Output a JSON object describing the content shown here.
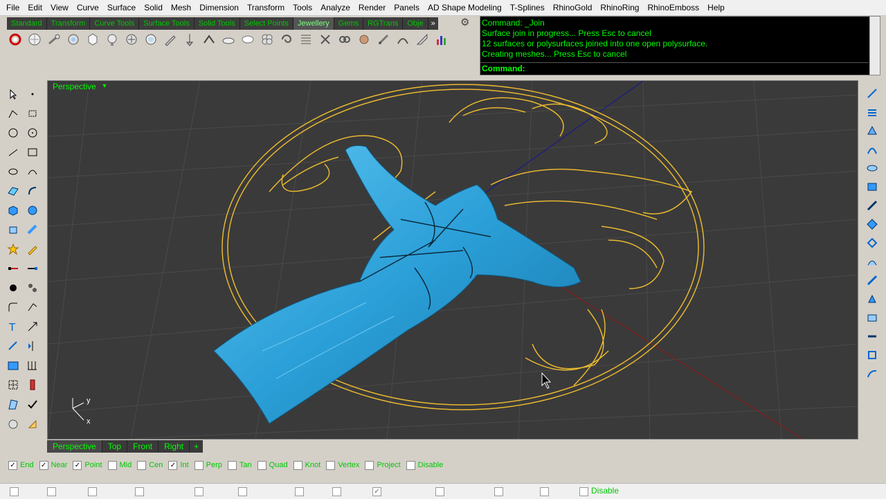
{
  "menubar": {
    "items": [
      "File",
      "Edit",
      "View",
      "Curve",
      "Surface",
      "Solid",
      "Mesh",
      "Dimension",
      "Transform",
      "Tools",
      "Analyze",
      "Render",
      "Panels",
      "AD Shape Modeling",
      "T-Splines",
      "RhinoGold",
      "RhinoRing",
      "RhinoEmboss",
      "Help"
    ]
  },
  "toolbar": {
    "tabs": [
      "Standard",
      "Transform",
      "Curve Tools",
      "Surface Tools",
      "Solid Tools",
      "Select Points",
      "Jewellery",
      "Gems",
      "RGTrans",
      "Obje"
    ],
    "more": "»",
    "active_tab": "Jewellery",
    "icon_names": [
      "ring-icon",
      "gem-cut-icon",
      "setting-icon",
      "prong-icon",
      "bezel-icon",
      "head-icon",
      "chain-icon",
      "pave-icon",
      "cutter-icon",
      "pin-icon",
      "channel-icon",
      "band-icon",
      "pearl-icon",
      "flower-icon",
      "spiral-icon",
      "texture-icon",
      "bracelet-icon",
      "link-icon",
      "bead-icon",
      "clasp-icon",
      "wire-icon",
      "knife-icon",
      "bar-chart-icon"
    ]
  },
  "command": {
    "history": [
      "Command: _Join",
      "Surface join in progress... Press Esc to cancel",
      "12 surfaces or polysurfaces joined into one open polysurface.",
      "Creating meshes... Press Esc to cancel"
    ],
    "prompt": "Command:"
  },
  "viewport": {
    "title": "Perspective",
    "menu_arrow": "▾",
    "axis": {
      "x": "x",
      "y": "y"
    }
  },
  "viewport_tabs": {
    "items": [
      "Perspective",
      "Top",
      "Front",
      "Right"
    ],
    "active": "Perspective",
    "add": "+"
  },
  "osnap": {
    "items": [
      {
        "label": "End",
        "checked": true
      },
      {
        "label": "Near",
        "checked": true
      },
      {
        "label": "Point",
        "checked": true
      },
      {
        "label": "Mid",
        "checked": false
      },
      {
        "label": "Cen",
        "checked": false
      },
      {
        "label": "Int",
        "checked": true
      },
      {
        "label": "Perp",
        "checked": false
      },
      {
        "label": "Tan",
        "checked": false
      },
      {
        "label": "Quad",
        "checked": false
      },
      {
        "label": "Knot",
        "checked": false
      },
      {
        "label": "Vertex",
        "checked": false
      },
      {
        "label": "Project",
        "checked": false
      },
      {
        "label": "Disable",
        "checked": false
      }
    ]
  },
  "statusbar": {
    "disable_label": "Disable"
  },
  "colors": {
    "viewport_bg": "#3a3a3a",
    "curve": "#e8b830",
    "surface": "#2b9fd8",
    "label_green": "#00ff00"
  }
}
